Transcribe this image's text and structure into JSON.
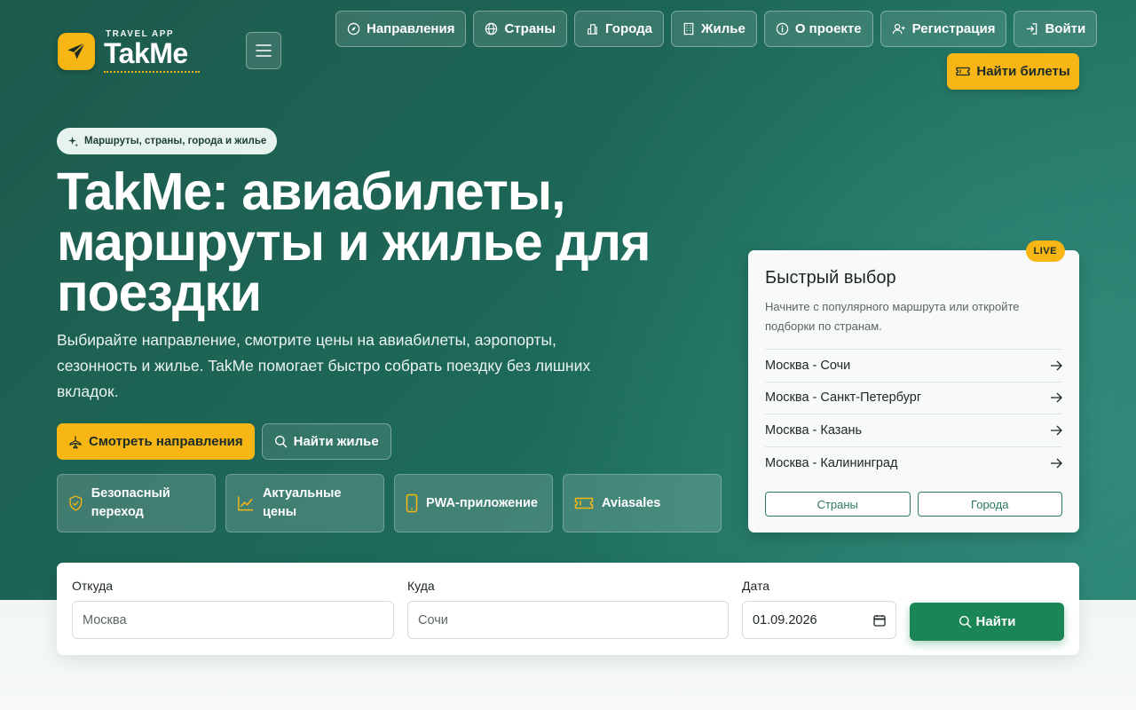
{
  "brand": {
    "subtitle": "TRAVEL APP",
    "name": "TakMe",
    "accent": "#f7b614",
    "primary_green": "#1a8555",
    "hero_bg": "#1d5a4c"
  },
  "nav": {
    "items": [
      {
        "label": "Направления",
        "icon": "compass-icon"
      },
      {
        "label": "Страны",
        "icon": "globe-icon"
      },
      {
        "label": "Города",
        "icon": "buildings-icon"
      },
      {
        "label": "Жилье",
        "icon": "building-icon"
      },
      {
        "label": "О проекте",
        "icon": "info-icon"
      },
      {
        "label": "Регистрация",
        "icon": "user-plus-icon"
      },
      {
        "label": "Войти",
        "icon": "login-icon"
      }
    ],
    "tickets_label": "Найти билеты"
  },
  "hero": {
    "pill": "Маршруты, страны, города и жилье",
    "title": "TakMe: авиабилеты, маршруты и жилье для поездки",
    "lead": "Выбирайте направление, смотрите цены на авиабилеты, аэропорты, сезонность и жилье. TakMe помогает быстро собрать поездку без лишних вкладок.",
    "cta_primary": "Смотреть направления",
    "cta_secondary": "Найти жилье",
    "features": [
      {
        "label": "Безопасный переход",
        "icon": "shield-check-icon"
      },
      {
        "label": "Актуальные цены",
        "icon": "chart-line-icon"
      },
      {
        "label": "PWA-приложение",
        "icon": "phone-icon"
      },
      {
        "label": "Aviasales",
        "icon": "ticket-icon"
      }
    ]
  },
  "quick": {
    "badge": "LIVE",
    "title": "Быстрый выбор",
    "description": "Начните с популярного маршрута или откройте подборки по странам.",
    "routes": [
      "Москва - Сочи",
      "Москва - Санкт-Петербург",
      "Москва - Казань",
      "Москва - Калининград"
    ],
    "buttons": [
      "Страны",
      "Города"
    ]
  },
  "search": {
    "from_label": "Откуда",
    "from_placeholder": "Москва",
    "to_label": "Куда",
    "to_placeholder": "Сочи",
    "date_label": "Дата",
    "date_value": "01.09.2026",
    "submit_label": "Найти"
  }
}
